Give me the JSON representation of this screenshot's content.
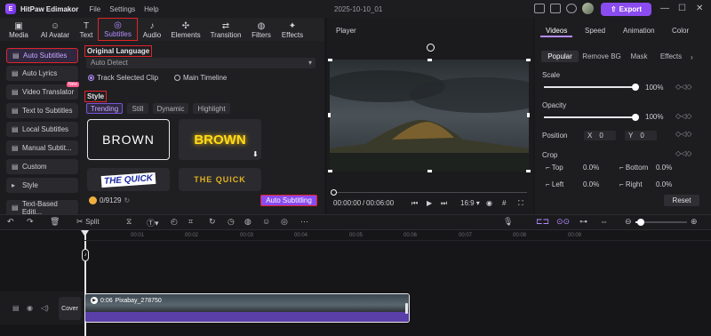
{
  "app": {
    "name": "HitPaw Edimakor",
    "menu": [
      "File",
      "Settings",
      "Help"
    ],
    "project": "2025-10-10_01",
    "export": "Export"
  },
  "tabs": [
    {
      "label": "Media",
      "icon": "media-icon"
    },
    {
      "label": "AI Avatar",
      "icon": "avatar-icon"
    },
    {
      "label": "Text",
      "icon": "text-icon"
    },
    {
      "label": "Subtitles",
      "icon": "subtitles-icon"
    },
    {
      "label": "Audio",
      "icon": "audio-icon"
    },
    {
      "label": "Elements",
      "icon": "elements-icon"
    },
    {
      "label": "Transition",
      "icon": "transition-icon"
    },
    {
      "label": "Filters",
      "icon": "filters-icon"
    },
    {
      "label": "Effects",
      "icon": "effects-icon"
    }
  ],
  "sidebar": [
    {
      "label": "Auto Subtitles"
    },
    {
      "label": "Auto Lyrics"
    },
    {
      "label": "Video Translator",
      "badge": "New"
    },
    {
      "label": "Text to Subtitles"
    },
    {
      "label": "Local Subtitles"
    },
    {
      "label": "Manual Subtit..."
    },
    {
      "label": "Custom"
    },
    {
      "label": "Style"
    },
    {
      "label": "Text-Based Editi..."
    }
  ],
  "panel": {
    "original_language": "Original Language",
    "language_value": "Auto Detect",
    "radio_track": "Track Selected Clip",
    "radio_main": "Main Timeline",
    "style": "Style",
    "chips": [
      "Trending",
      "Still",
      "Dynamic",
      "Highlight"
    ],
    "cards": [
      "BROWN",
      "BROWN",
      "THE QUICK",
      "THE QUICK"
    ],
    "credits": "0/9129",
    "auto_button": "Auto Subtitling"
  },
  "player": {
    "title": "Player",
    "time_current": "00:00:00",
    "time_total": "00:06:00",
    "aspect": "16:9"
  },
  "props": {
    "tabs": [
      "Videos",
      "Speed",
      "Animation",
      "Color"
    ],
    "subtabs": [
      "Popular",
      "Remove BG",
      "Mask",
      "Effects"
    ],
    "scale_label": "Scale",
    "scale_value": "100%",
    "opacity_label": "Opacity",
    "opacity_value": "100%",
    "position_label": "Position",
    "pos_x_label": "X",
    "pos_x": "0",
    "pos_y_label": "Y",
    "pos_y": "0",
    "crop_label": "Crop",
    "crop": [
      {
        "label": "Top",
        "value": "0.0%"
      },
      {
        "label": "Bottom",
        "value": "0.0%"
      },
      {
        "label": "Left",
        "value": "0.0%"
      },
      {
        "label": "Right",
        "value": "0.0%"
      }
    ],
    "reset": "Reset",
    "scale_level": 1.0,
    "opacity_level": 1.0
  },
  "timeline": {
    "split": "Split",
    "ticks": [
      "00:01",
      "00:02",
      "00:03",
      "00:04",
      "00:05",
      "00:06",
      "00:07",
      "00:08",
      "00:09"
    ],
    "cover": "Cover",
    "clip_duration": "0:06",
    "clip_name": "Pixabay_278750"
  }
}
